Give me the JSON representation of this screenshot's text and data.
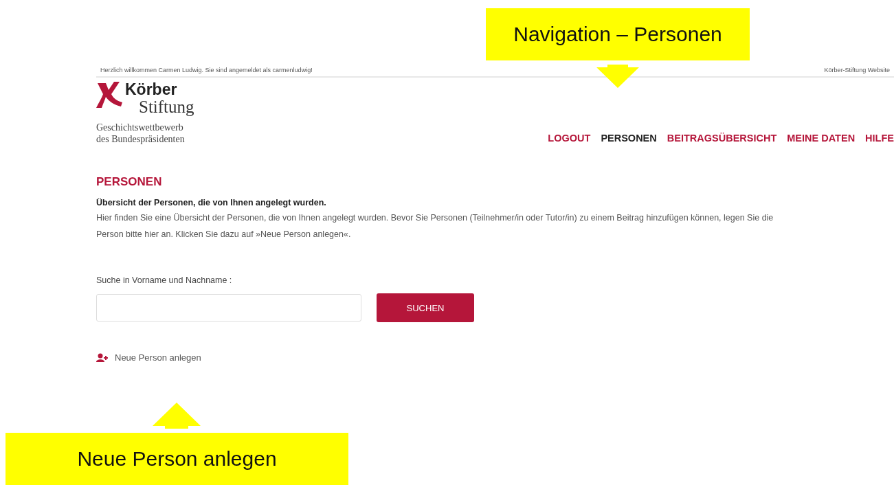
{
  "top_bar": {
    "welcome": "Herzlich willkommen Carmen Ludwig. Sie sind angemeldet als carmenludwig!",
    "website_link": "Körber-Stiftung Website"
  },
  "logo": {
    "line_1": "Körber",
    "line_2": "Stiftung",
    "subtitle_1": "Geschichtswettbewerb",
    "subtitle_2": "des Bundespräsidenten"
  },
  "nav": [
    {
      "label": "LOGOUT",
      "selected": false
    },
    {
      "label": "PERSONEN",
      "selected": true
    },
    {
      "label": "BEITRAGSÜBERSICHT",
      "selected": false
    },
    {
      "label": "MEINE DATEN",
      "selected": false
    },
    {
      "label": "HILFE",
      "selected": false
    }
  ],
  "page": {
    "heading": "PERSONEN",
    "lead": "Übersicht der Personen, die von Ihnen angelegt wurden.",
    "text": "Hier finden Sie eine Übersicht der Personen, die von Ihnen angelegt wurden. Bevor Sie Personen (Teilnehmer/in oder Tutor/in) zu einem Beitrag hinzufügen können, legen Sie die Person bitte hier an. Klicken Sie dazu auf »Neue Person anlegen«."
  },
  "search": {
    "label": "Suche in Vorname und Nachname :",
    "button": "SUCHEN"
  },
  "new_person_link": "Neue Person anlegen",
  "callouts": [
    {
      "text": "Navigation – Personen",
      "kind": "down"
    },
    {
      "text": "Neue Person anlegen",
      "kind": "up"
    }
  ]
}
